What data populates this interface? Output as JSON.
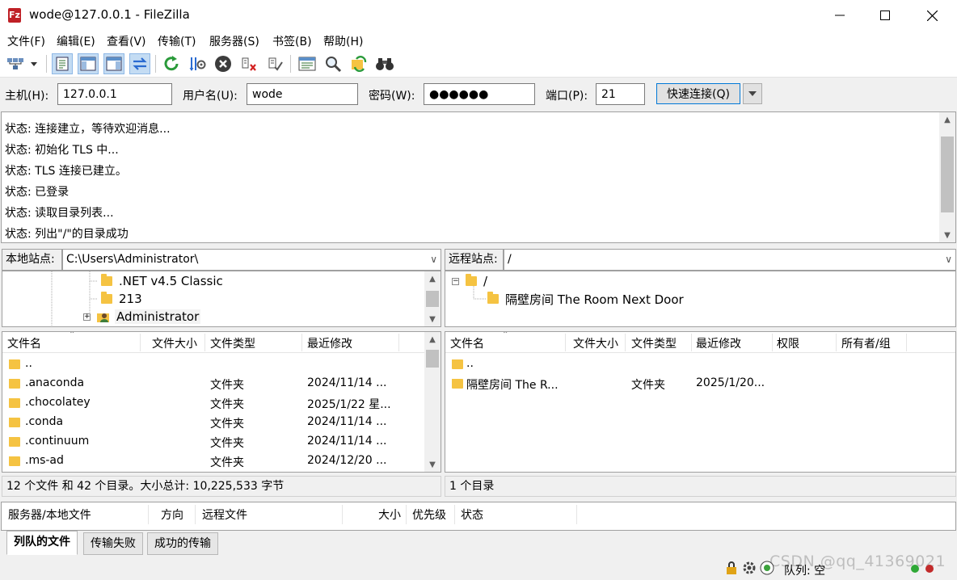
{
  "window": {
    "icon_text": "Fz",
    "title": "wode@127.0.0.1 - FileZilla"
  },
  "menu": [
    "文件(F)",
    "编辑(E)",
    "查看(V)",
    "传输(T)",
    "服务器(S)",
    "书签(B)",
    "帮助(H)"
  ],
  "quickconnect": {
    "host_label": "主机(H):",
    "host_value": "127.0.0.1",
    "user_label": "用户名(U):",
    "user_value": "wode",
    "pass_label": "密码(W):",
    "pass_value": "●●●●●●",
    "port_label": "端口(P):",
    "port_value": "21",
    "connect_label": "快速连接(Q)"
  },
  "log": [
    "状态: 连接建立，等待欢迎消息...",
    "状态: 初始化 TLS 中...",
    "状态: TLS 连接已建立。",
    "状态: 已登录",
    "状态: 读取目录列表...",
    "状态: 列出\"/\"的目录成功"
  ],
  "local": {
    "site_label": "本地站点:",
    "path": "C:\\Users\\Administrator\\",
    "tree": [
      ".NET v4.5 Classic",
      "213",
      "Administrator"
    ],
    "headers": [
      "文件名",
      "文件大小",
      "文件类型",
      "最近修改"
    ],
    "rows": [
      {
        "name": "..",
        "size": "",
        "type": "",
        "modified": ""
      },
      {
        "name": ".anaconda",
        "size": "",
        "type": "文件夹",
        "modified": "2024/11/14 ..."
      },
      {
        "name": ".chocolatey",
        "size": "",
        "type": "文件夹",
        "modified": "2025/1/22 星..."
      },
      {
        "name": ".conda",
        "size": "",
        "type": "文件夹",
        "modified": "2024/11/14 ..."
      },
      {
        "name": ".continuum",
        "size": "",
        "type": "文件夹",
        "modified": "2024/11/14 ..."
      },
      {
        "name": ".ms-ad",
        "size": "",
        "type": "文件夹",
        "modified": "2024/12/20 ..."
      }
    ],
    "summary": "12 个文件 和 42 个目录。大小总计: 10,225,533 字节"
  },
  "remote": {
    "site_label": "远程站点:",
    "path": "/",
    "tree": [
      "/",
      "隔壁房间 The Room Next Door"
    ],
    "headers": [
      "文件名",
      "文件大小",
      "文件类型",
      "最近修改",
      "权限",
      "所有者/组"
    ],
    "rows": [
      {
        "name": "..",
        "size": "",
        "type": "",
        "modified": "",
        "perm": "",
        "owner": ""
      },
      {
        "name": "隔壁房间 The R...",
        "size": "",
        "type": "文件夹",
        "modified": "2025/1/20...",
        "perm": "",
        "owner": ""
      }
    ],
    "summary": "1 个目录"
  },
  "queue_headers": [
    "服务器/本地文件",
    "方向",
    "远程文件",
    "大小",
    "优先级",
    "状态"
  ],
  "tabs": [
    "列队的文件",
    "传输失败",
    "成功的传输"
  ],
  "statusbar": {
    "queue": "队列: 空",
    "watermark": "CSDN @qq_41369021"
  },
  "icons": {
    "site_manager": "site-manager-icon",
    "refresh": "refresh-icon",
    "cancel": "cancel-icon",
    "search": "search-icon",
    "lock": "lock-icon"
  },
  "colors": {
    "accent": "#0078d7",
    "folder": "#f5c342",
    "app_icon": "#bf2026"
  }
}
